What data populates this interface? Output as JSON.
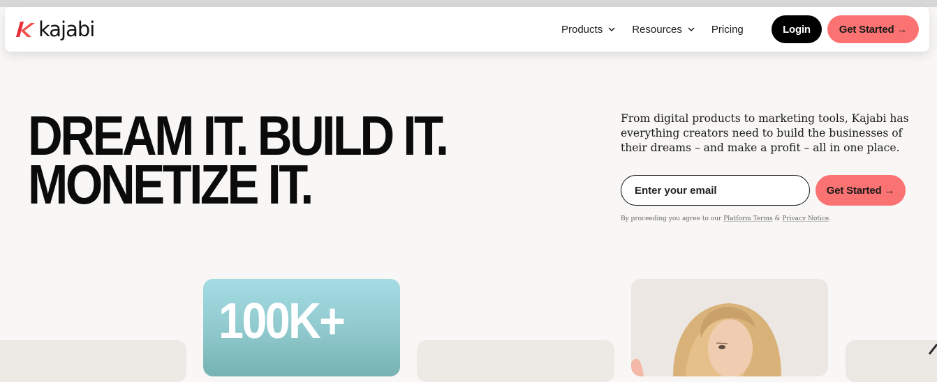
{
  "brand": {
    "name": "kajabi",
    "accent": "#fb7272"
  },
  "nav": {
    "products": "Products",
    "resources": "Resources",
    "pricing": "Pricing",
    "login": "Login",
    "get_started": "Get Started →"
  },
  "hero": {
    "title_line1": "DREAM IT. BUILD IT.",
    "title_line2": "MONETIZE IT.",
    "description": "From digital products to marketing tools, Kajabi has everything creators need to build the businesses of their dreams – and make a profit – all in one place.",
    "email_placeholder": "Enter your email",
    "cta": "Get Started →",
    "consent_prefix": "By proceeding you agree to our ",
    "consent_terms": "Platform Terms",
    "consent_and": " & ",
    "consent_privacy": "Privacy Notice",
    "consent_suffix": "."
  },
  "cards": {
    "stat": "100K+"
  }
}
